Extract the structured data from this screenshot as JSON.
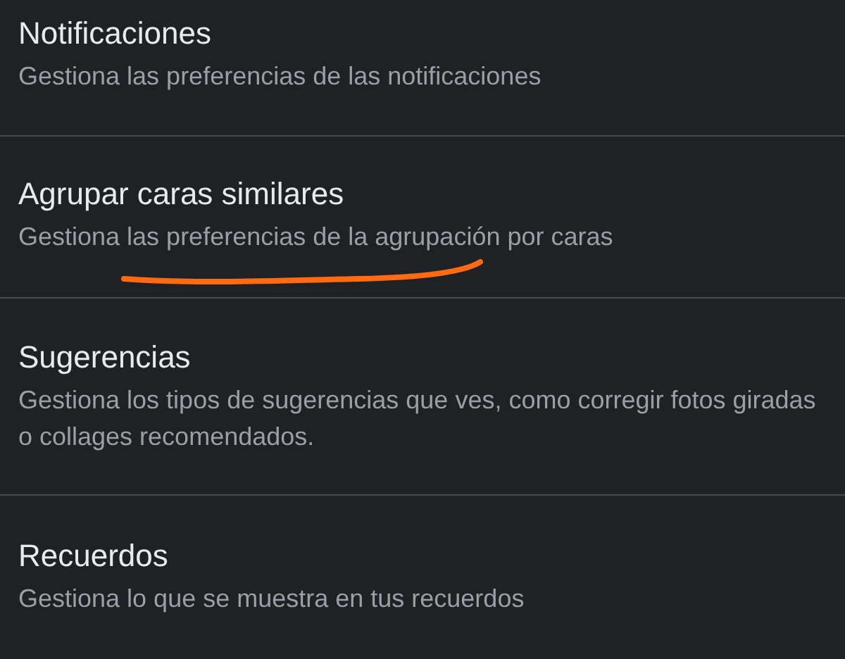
{
  "settings": [
    {
      "title": "Notificaciones",
      "description": "Gestiona las preferencias de las notificaciones"
    },
    {
      "title": "Agrupar caras similares",
      "description": "Gestiona las preferencias de la agrupación por caras",
      "annotated": true
    },
    {
      "title": "Sugerencias",
      "description": "Gestiona los tipos de sugerencias que ves, como corregir fotos giradas o collages recomendados."
    },
    {
      "title": "Recuerdos",
      "description": "Gestiona lo que se muestra en tus recuerdos"
    }
  ]
}
